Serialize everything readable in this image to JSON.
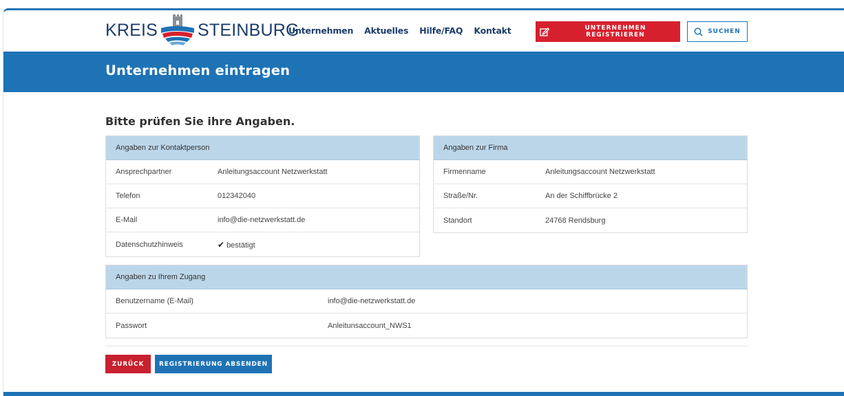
{
  "header": {
    "logo_left": "KREIS",
    "logo_right": "STEINBURG",
    "nav": [
      "Unternehmen",
      "Aktuelles",
      "Hilfe/FAQ",
      "Kontakt"
    ],
    "register_label": "UNTERNEHMEN REGISTRIEREN",
    "search_label": "SUCHEN"
  },
  "banner": {
    "title": "Unternehmen eintragen"
  },
  "main": {
    "subtitle": "Bitte prüfen Sie ihre Angaben.",
    "contact": {
      "title": "Angaben zur Kontaktperson",
      "rows": [
        {
          "label": "Ansprechpartner",
          "value": "Anleitungsaccount Netzwerkstatt"
        },
        {
          "label": "Telefon",
          "value": "012342040"
        },
        {
          "label": "E-Mail",
          "value": "info@die-netzwerkstatt.de"
        },
        {
          "label": "Datenschutzhinweis",
          "value": "bestätigt"
        }
      ]
    },
    "company": {
      "title": "Angaben zur Firma",
      "rows": [
        {
          "label": "Firmenname",
          "value": "Anleitungsaccount Netzwerkstatt"
        },
        {
          "label": "Straße/Nr.",
          "value": "An der Schiffbrücke 2"
        },
        {
          "label": "Standort",
          "value": "24768 Rendsburg"
        }
      ]
    },
    "access": {
      "title": "Angaben zu Ihrem Zugang",
      "rows": [
        {
          "label": "Benutzername (E-Mail)",
          "value": "info@die-netzwerkstatt.de"
        },
        {
          "label": "Passwort",
          "value": "Anleitunsaccount_NWS1"
        }
      ]
    },
    "back_label": "ZURÜCK",
    "submit_label": "REGISTRIERUNG ABSENDEN"
  },
  "colors": {
    "primary": "#1e73b5",
    "accent": "#d7202e",
    "panel_head": "#bcd6e9",
    "logo_text": "#1d3d6b"
  }
}
